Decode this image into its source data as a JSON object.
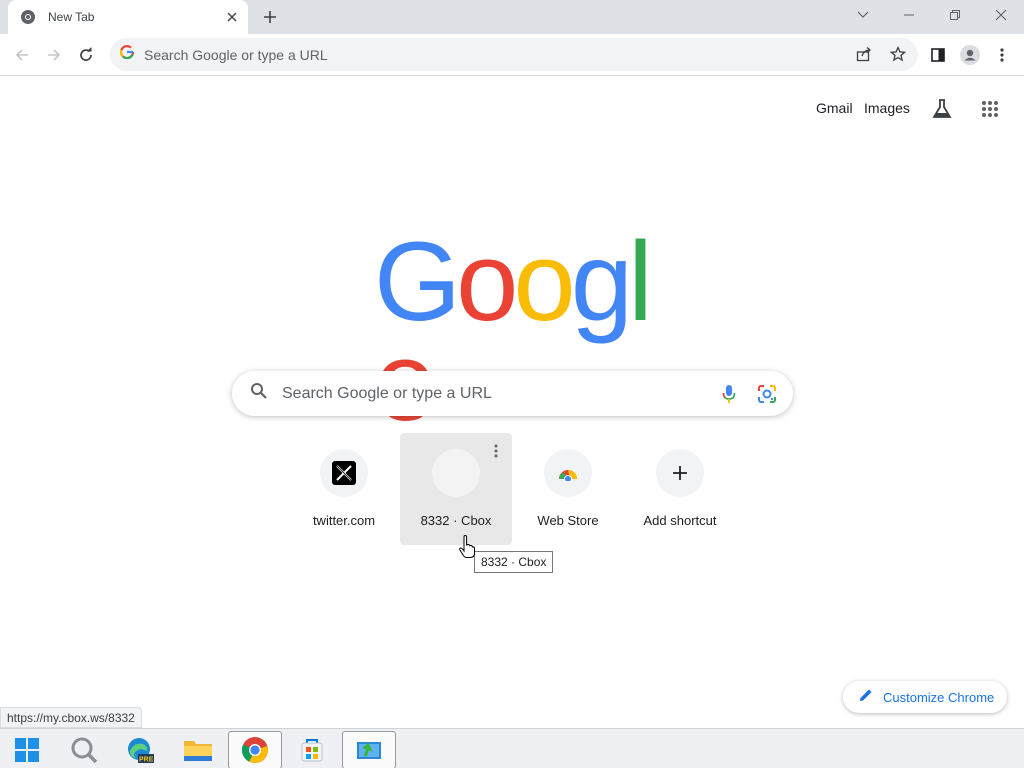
{
  "browser": {
    "tab_title": "New Tab",
    "omnibox_placeholder": "Search Google or type a URL"
  },
  "ntp": {
    "top_links": {
      "gmail": "Gmail",
      "images": "Images"
    },
    "logo": {
      "letters": [
        "G",
        "o",
        "o",
        "g",
        "l",
        "e"
      ],
      "colors": [
        "#4285f4",
        "#ea4335",
        "#fbbc05",
        "#4285f4",
        "#34a853",
        "#ea4335"
      ]
    },
    "search_placeholder": "Search Google or type a URL",
    "shortcuts": [
      {
        "label": "twitter.com",
        "icon": "x-logo-icon"
      },
      {
        "label": "8332 · Cbox",
        "icon": "blank-favicon-icon"
      },
      {
        "label": "Web Store",
        "icon": "web-store-icon"
      },
      {
        "label": "Add shortcut",
        "icon": "plus-icon"
      }
    ],
    "tooltip": "8332 · Cbox",
    "customize_label": "Customize Chrome"
  },
  "status_url": "https://my.cbox.ws/8332",
  "taskbar": {
    "items": [
      "start-icon",
      "search-icon",
      "edge-pre-icon",
      "file-explorer-icon",
      "chrome-icon",
      "store-icon",
      "app-installer-icon"
    ]
  },
  "colors": {
    "accent": "#1a73e8",
    "hover_tile": "#e8e8e8"
  }
}
